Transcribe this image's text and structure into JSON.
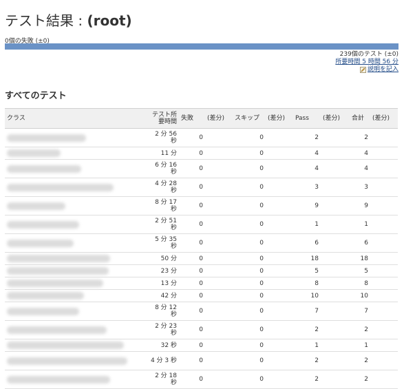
{
  "header": {
    "title_prefix": "テスト結果 : ",
    "title_root": "(root)",
    "fail_summary": "0個の失敗 (±0)",
    "test_count": "239個のテスト (±0)",
    "duration_link": "所要時間 5 時間 56 分",
    "edit_description": "説明を記入"
  },
  "progress": {
    "fail_fraction": 0.0
  },
  "section_title": "すべてのテスト",
  "table": {
    "headers": {
      "class": "クラス",
      "duration": "テスト所要時間",
      "fail": "失敗",
      "fail_diff": "(差分)",
      "skip": "スキップ",
      "skip_diff": "(差分)",
      "pass": "Pass",
      "pass_diff": "(差分)",
      "total": "合計",
      "total_diff": "(差分)"
    },
    "rows": [
      {
        "duration": "2 分 56 秒",
        "fail": "0",
        "skip": "0",
        "pass": "2",
        "total": "2"
      },
      {
        "duration": "11 分",
        "fail": "0",
        "skip": "0",
        "pass": "4",
        "total": "4"
      },
      {
        "duration": "6 分 16 秒",
        "fail": "0",
        "skip": "0",
        "pass": "4",
        "total": "4"
      },
      {
        "duration": "4 分 28 秒",
        "fail": "0",
        "skip": "0",
        "pass": "3",
        "total": "3"
      },
      {
        "duration": "8 分 17 秒",
        "fail": "0",
        "skip": "0",
        "pass": "9",
        "total": "9"
      },
      {
        "duration": "2 分 51 秒",
        "fail": "0",
        "skip": "0",
        "pass": "1",
        "total": "1"
      },
      {
        "duration": "5 分 35 秒",
        "fail": "0",
        "skip": "0",
        "pass": "6",
        "total": "6"
      },
      {
        "duration": "50 分",
        "fail": "0",
        "skip": "0",
        "pass": "18",
        "total": "18"
      },
      {
        "duration": "23 分",
        "fail": "0",
        "skip": "0",
        "pass": "5",
        "total": "5"
      },
      {
        "duration": "13 分",
        "fail": "0",
        "skip": "0",
        "pass": "8",
        "total": "8"
      },
      {
        "duration": "42 分",
        "fail": "0",
        "skip": "0",
        "pass": "10",
        "total": "10"
      },
      {
        "duration": "8 分 12 秒",
        "fail": "0",
        "skip": "0",
        "pass": "7",
        "total": "7"
      },
      {
        "duration": "2 分 23 秒",
        "fail": "0",
        "skip": "0",
        "pass": "2",
        "total": "2"
      },
      {
        "duration": "32 秒",
        "fail": "0",
        "skip": "0",
        "pass": "1",
        "total": "1"
      },
      {
        "duration": "4 分 3 秒",
        "fail": "0",
        "skip": "0",
        "pass": "2",
        "total": "2"
      },
      {
        "duration": "2 分 18 秒",
        "fail": "0",
        "skip": "0",
        "pass": "2",
        "total": "2"
      }
    ]
  },
  "colors": {
    "progress_bar": "#6a92c6",
    "link": "#204a87"
  }
}
